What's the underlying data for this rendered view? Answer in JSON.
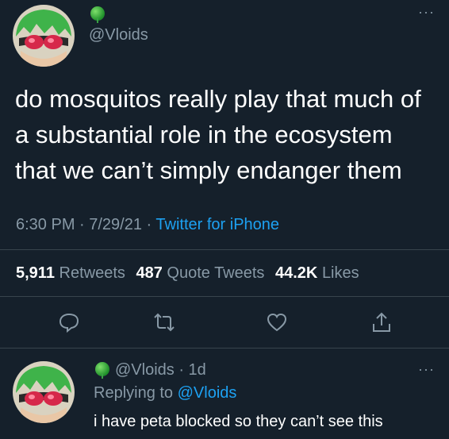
{
  "tweet": {
    "handle": "@Vloids",
    "text": "do mosquitos really play that much of a substantial role in the ecosystem that we can’t simply endanger them",
    "time": "6:30 PM · 7/29/21 · ",
    "source": "Twitter for iPhone",
    "more_icon": "more-dots-icon"
  },
  "stats": {
    "retweets_count": "5,911",
    "retweets_label": "Retweets",
    "quotes_count": "487",
    "quotes_label": "Quote Tweets",
    "likes_count": "44.2K",
    "likes_label": "Likes"
  },
  "actions": [
    "reply-icon",
    "retweet-icon",
    "like-icon",
    "share-icon"
  ],
  "reply": {
    "handle": "@Vloids",
    "age": " · 1d",
    "replying_prefix": "Replying to ",
    "replying_to": "@Vloids",
    "text": "i have peta blocked so they can’t see this"
  },
  "colors": {
    "background": "#15202b",
    "secondary_text": "#8899a6",
    "link": "#1da1f2"
  }
}
